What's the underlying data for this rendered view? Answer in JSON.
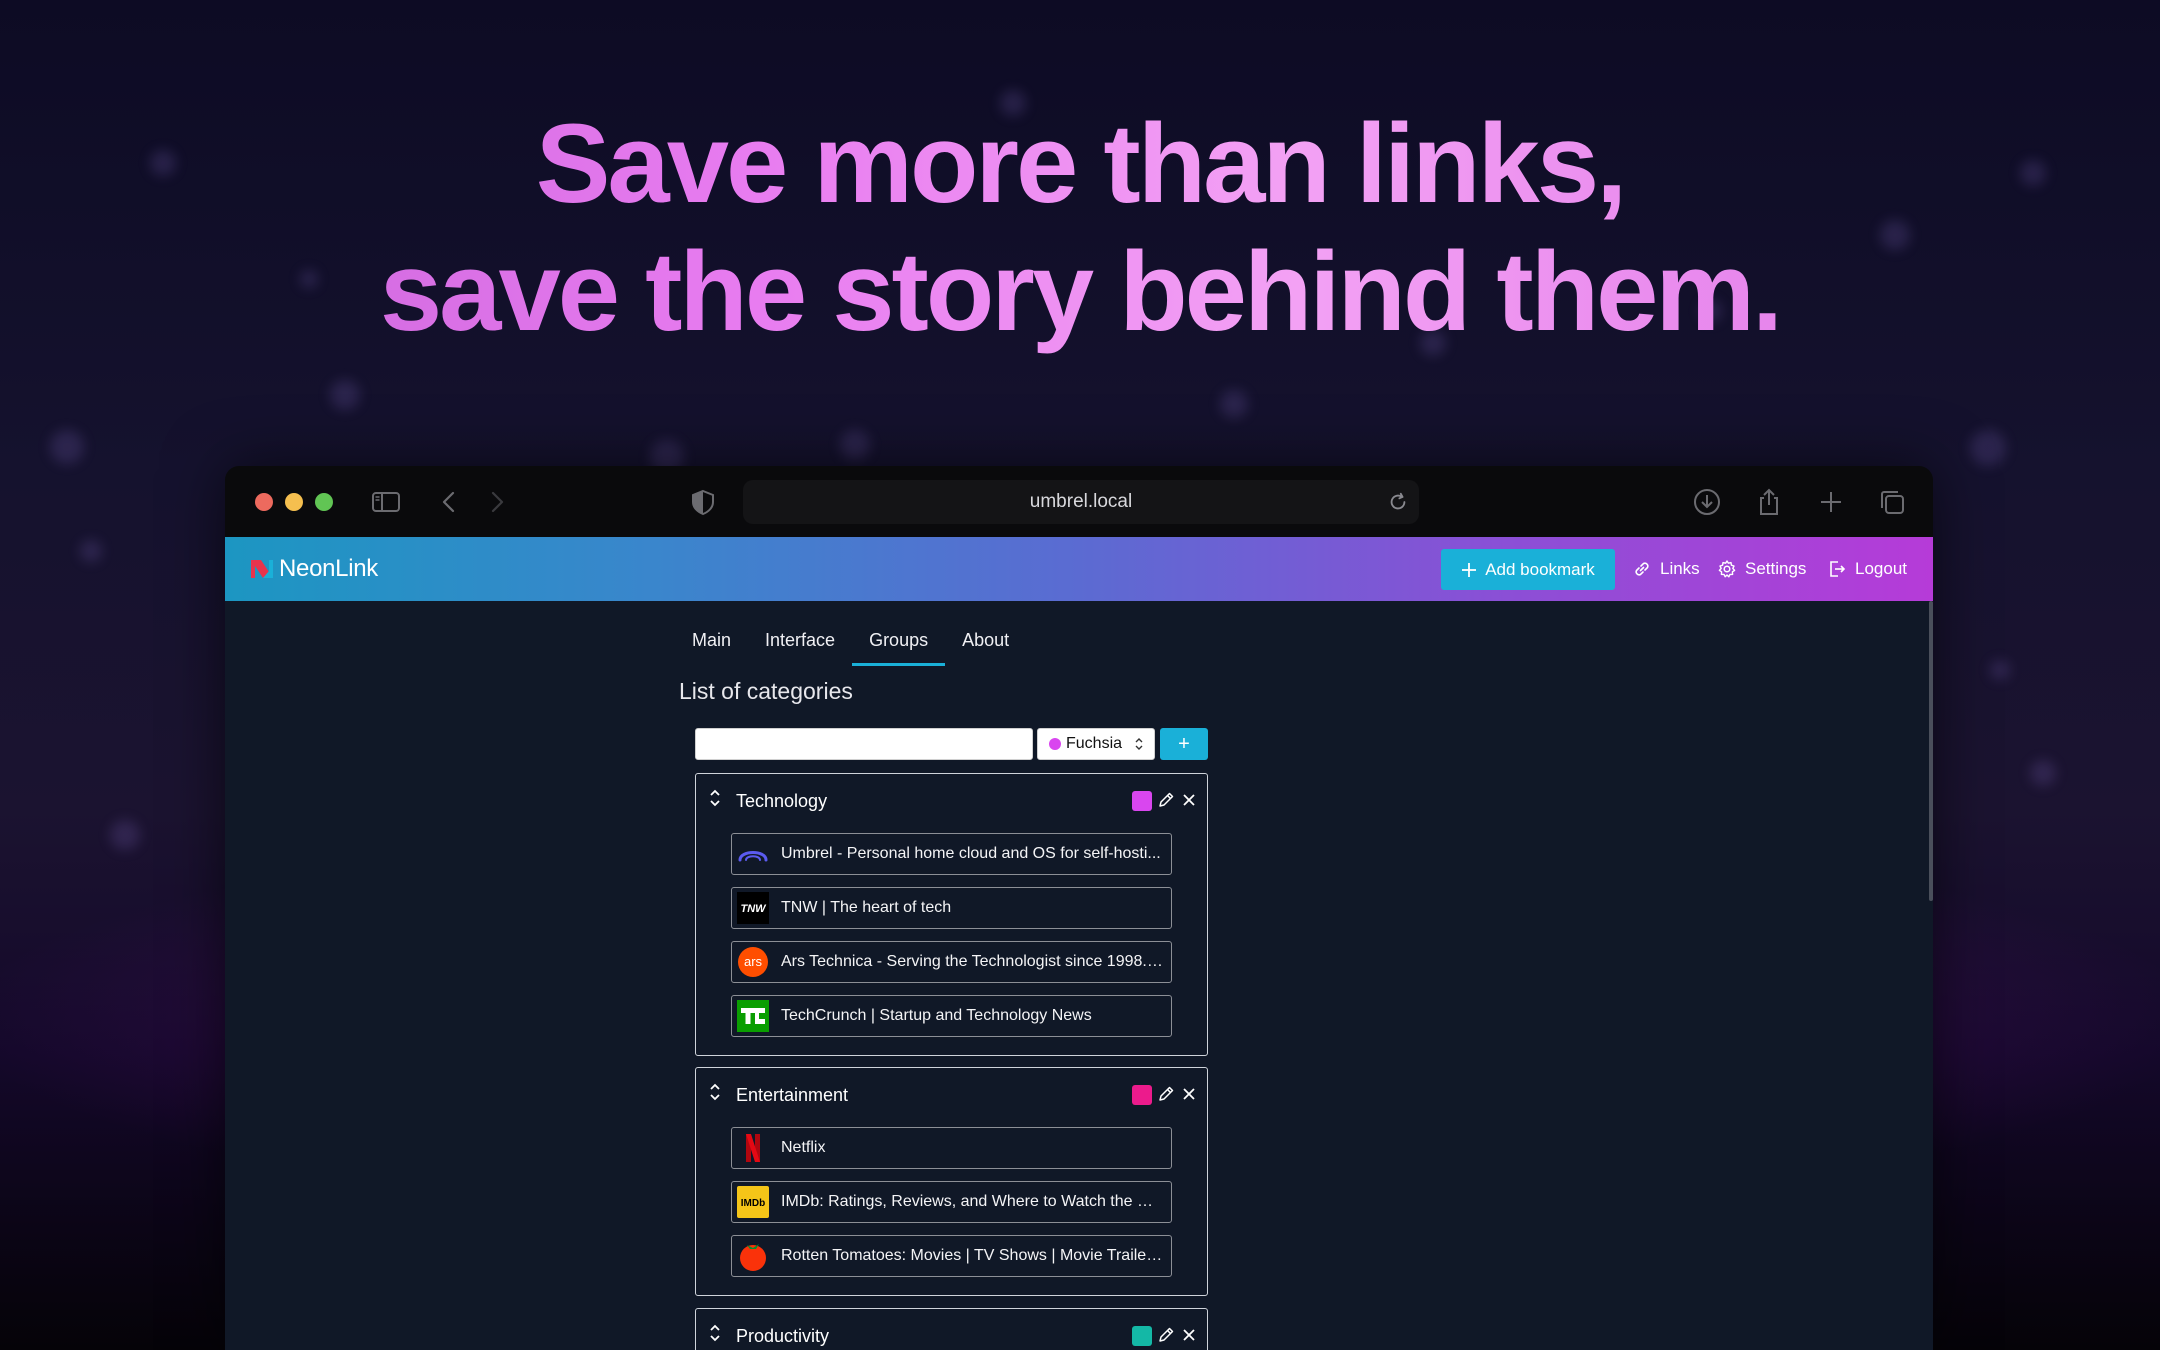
{
  "headline": {
    "line1": "Save more than links,",
    "line2": "save the story behind them."
  },
  "browser": {
    "url": "umbrel.local"
  },
  "navbar": {
    "brand": "NeonLink",
    "add_bookmark": "Add bookmark",
    "links": "Links",
    "settings": "Settings",
    "logout": "Logout"
  },
  "tabs": [
    {
      "label": "Main"
    },
    {
      "label": "Interface"
    },
    {
      "label": "Groups"
    },
    {
      "label": "About"
    }
  ],
  "active_tab": "Groups",
  "section_title": "List of categories",
  "new_group": {
    "name_value": "",
    "color_selected": "Fuchsia",
    "add_label": "+"
  },
  "groups": [
    {
      "name": "Technology",
      "color": "#d946ef",
      "links": [
        {
          "title": "Umbrel - Personal home cloud and OS for self-hosti...",
          "icon": "umbrel-icon"
        },
        {
          "title": "TNW | The heart of tech",
          "icon": "tnw-icon"
        },
        {
          "title": "Ars Technica - Serving the Technologist since 1998. ...",
          "icon": "ars-technica-icon"
        },
        {
          "title": "TechCrunch | Startup and Technology News",
          "icon": "techcrunch-icon"
        }
      ]
    },
    {
      "name": "Entertainment",
      "color": "#ec1b8c",
      "links": [
        {
          "title": "Netflix",
          "icon": "netflix-icon"
        },
        {
          "title": "IMDb: Ratings, Reviews, and Where to Watch the Be...",
          "icon": "imdb-icon"
        },
        {
          "title": "Rotten Tomatoes: Movies | TV Shows | Movie Trailers...",
          "icon": "rotten-tomatoes-icon"
        }
      ]
    },
    {
      "name": "Productivity",
      "color": "#14b8a6",
      "links": []
    }
  ],
  "favicon_text": {
    "tnw": "TNW",
    "ars": "ars",
    "imdb": "IMDb"
  }
}
